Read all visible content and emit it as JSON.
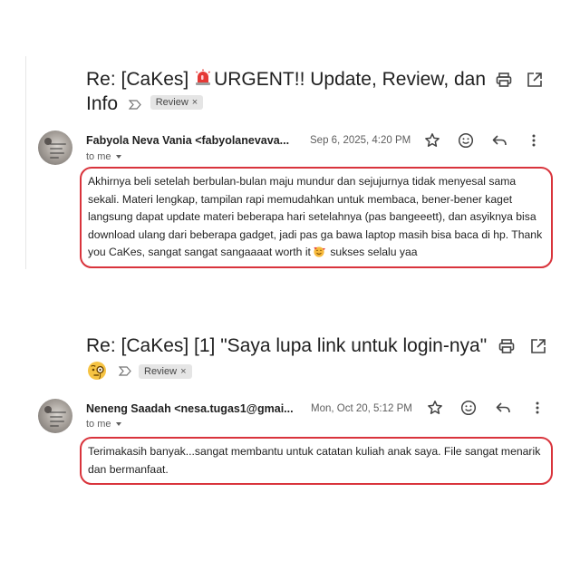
{
  "emails": [
    {
      "subject_line1_pre": "Re: [CaKes] ",
      "subject_line1_post": "URGENT!! Update, Review, dan",
      "subject_line2": "Info",
      "subject_emoji": "siren-emoji",
      "label": "Review",
      "sender": "Fabyola Neva Vania <fabyolanevava...",
      "date": "Sep 6, 2025, 4:20 PM",
      "to": "to me",
      "body_pre": "Akhirnya beli setelah berbulan-bulan maju mundur dan sejujurnya tidak menyesal sama sekali. Materi lengkap, tampilan rapi memudahkan untuk membaca, bener-bener kaget langsung dapat update materi beberapa hari setelahnya (pas bangeeett), dan asyiknya bisa download ulang dari beberapa gadget, jadi pas ga bawa laptop masih bisa baca di hp. Thank you CaKes, sangat sangat sangaaaat worth it",
      "body_emoji": "smiling-face-with-hearts-emoji",
      "body_post": " sukses selalu yaa"
    },
    {
      "subject_line1": "Re: [CaKes] [1] \"Saya lupa link untuk login-nya\"",
      "subject_emoji": "face-with-monocle-emoji",
      "label": "Review",
      "sender": "Neneng Saadah <nesa.tugas1@gmai...",
      "date": "Mon, Oct 20, 5:12 PM",
      "to": "to me",
      "body": "Terimakasih banyak...sangat membantu untuk catatan kuliah anak saya. File sangat menarik dan bermanfaat."
    }
  ],
  "icons": [
    "print-icon",
    "open-in-new-icon",
    "star-icon",
    "emoji-reaction-icon",
    "reply-icon",
    "more-vert-icon",
    "important-marker-icon",
    "label-remove-icon"
  ],
  "colors": {
    "highlight_border": "#d9343c",
    "label_bg": "#e5e5e5",
    "text": "#1f1f1f",
    "muted": "#5e5e5e"
  }
}
